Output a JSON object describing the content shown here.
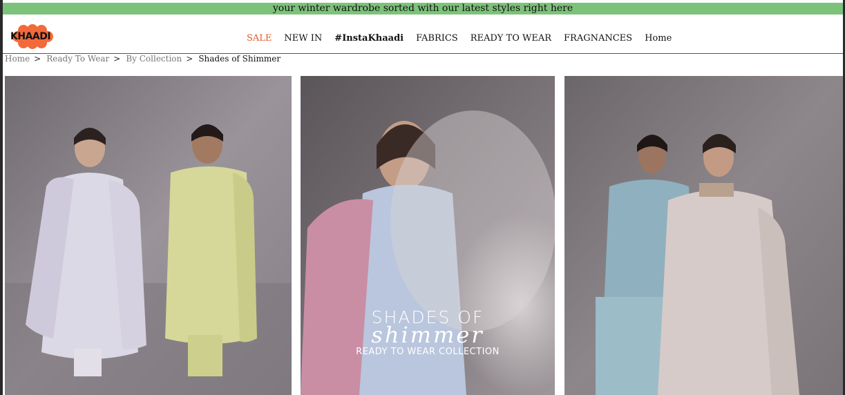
{
  "banner": {
    "text": "your winter wardrobe sorted with our latest styles right here"
  },
  "brand": {
    "logo_text": "KHAADI",
    "logo_color": "#f26a3b"
  },
  "nav": {
    "items": [
      {
        "label": "SALE",
        "color": "#e2572b"
      },
      {
        "label": "NEW IN"
      },
      {
        "label": "#InstaKhaadi"
      },
      {
        "label": "FABRICS"
      },
      {
        "label": "READY TO WEAR"
      },
      {
        "label": "FRAGNANCES"
      },
      {
        "label": "Home"
      }
    ]
  },
  "breadcrumb": {
    "items": [
      "Home",
      "Ready To Wear",
      "By Collection",
      "Shades of Shimmer"
    ],
    "separator": ">"
  },
  "hero": {
    "title_line1": "SHADES OF",
    "title_line2": "shimmer",
    "subtitle": "READY TO WEAR COLLECTION"
  },
  "colors": {
    "banner_bg": "#7dc27a",
    "sale": "#e2572b"
  }
}
